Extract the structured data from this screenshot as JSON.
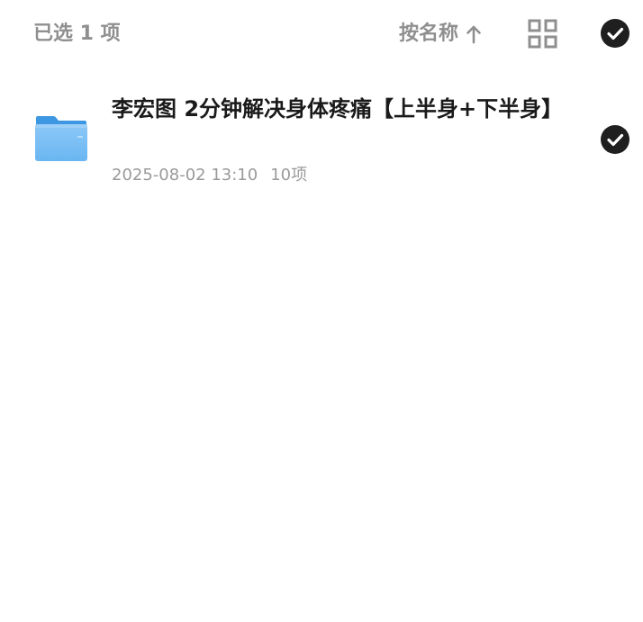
{
  "toolbar": {
    "selected_count": "已选 1 项",
    "sort_label": "按名称",
    "sort_direction_icon": "arrow-up-icon",
    "view_toggle_icon": "grid-view-icon",
    "select_all_icon": "check-circle-icon"
  },
  "files": [
    {
      "name": "李宏图 2分钟解决身体疼痛【上半身+下半身】",
      "date": "2025-08-02 13:10",
      "item_count": "10项",
      "icon": "folder-icon",
      "selected": true
    }
  ],
  "colors": {
    "muted_text": "#8f8f8f",
    "primary_text": "#1a1a1a",
    "check_fill": "#1f1f1f",
    "folder_blue": "#5aa9ea"
  }
}
